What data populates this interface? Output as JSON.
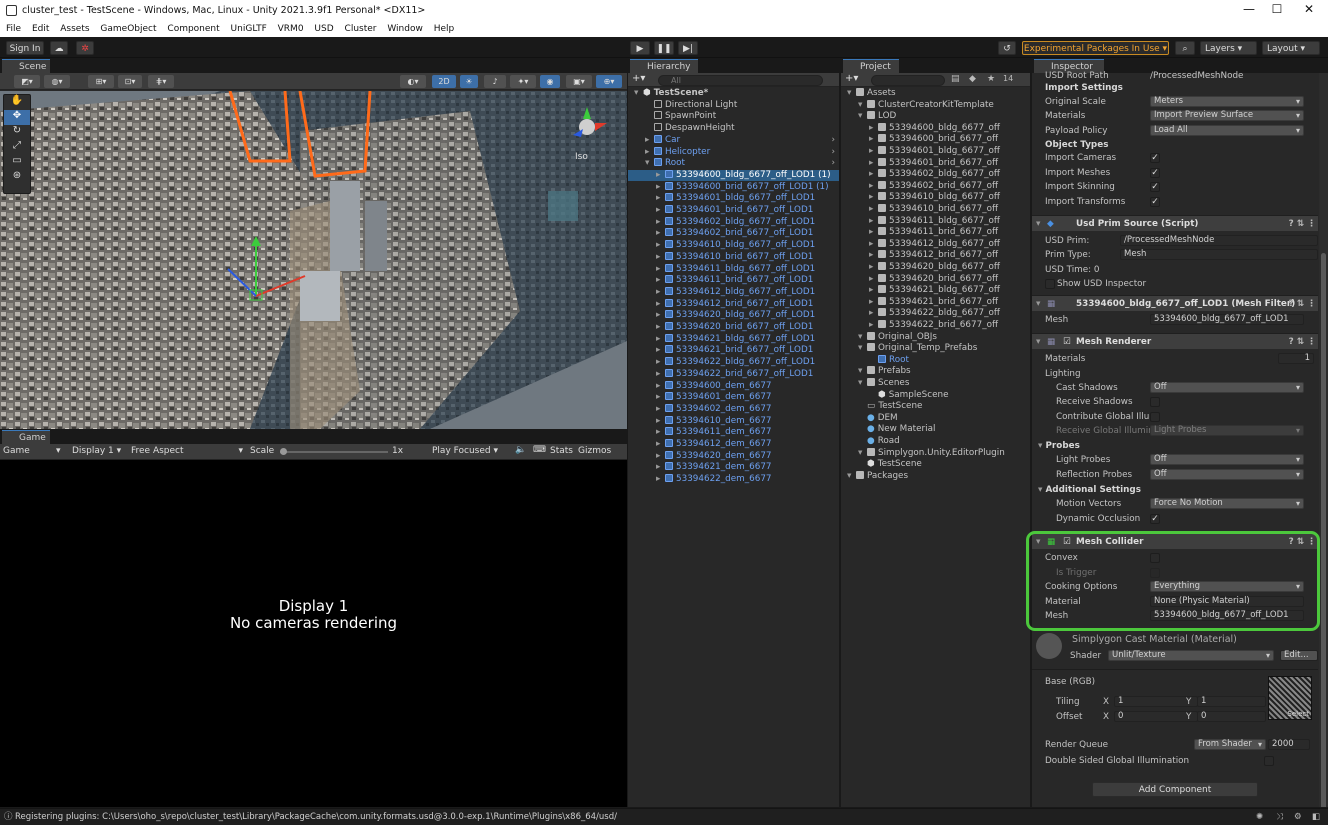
{
  "window": {
    "title": "cluster_test - TestScene - Windows, Mac, Linux - Unity 2021.3.9f1 Personal* <DX11>",
    "min": "—",
    "max": "☐",
    "close": "✕"
  },
  "menu": [
    "File",
    "Edit",
    "Assets",
    "GameObject",
    "Component",
    "UniGLTF",
    "VRM0",
    "USD",
    "Cluster",
    "Window",
    "Help"
  ],
  "toolbar": {
    "sign_in": "Sign In",
    "experimental": "Experimental Packages In Use ▾",
    "layers": "Layers",
    "layout": "Layout"
  },
  "scene": {
    "tab": "Scene",
    "mode_2d": "2D",
    "persp": "Iso",
    "colors": {
      "tab_accent": "#3a79bb",
      "selection": "#ff6a1a"
    }
  },
  "game": {
    "tab": "Game",
    "view": "Game",
    "display": "Display 1",
    "aspect": "Free Aspect",
    "scale_label": "Scale",
    "scale_value": "1x",
    "play_focused": "Play Focused",
    "stats": "Stats",
    "gizmos": "Gizmos",
    "msg_line1": "Display 1",
    "msg_line2": "No cameras rendering"
  },
  "hierarchy": {
    "tab": "Hierarchy",
    "search_placeholder": "All",
    "items": [
      {
        "label": "TestScene*",
        "depth": 0,
        "kind": "scene"
      },
      {
        "label": "Directional Light",
        "depth": 1,
        "kind": "go"
      },
      {
        "label": "SpawnPoint",
        "depth": 1,
        "kind": "go"
      },
      {
        "label": "DespawnHeight",
        "depth": 1,
        "kind": "go"
      },
      {
        "label": "Car",
        "depth": 1,
        "kind": "prefab",
        "arrow": true
      },
      {
        "label": "Helicopter",
        "depth": 1,
        "kind": "prefab",
        "arrow": true
      },
      {
        "label": "Root",
        "depth": 1,
        "kind": "prefab",
        "arrow": true
      },
      {
        "label": "53394600_bldg_6677_off_LOD1 (1)",
        "depth": 2,
        "kind": "prefab",
        "selected": true
      },
      {
        "label": "53394600_brid_6677_off_LOD1 (1)",
        "depth": 2,
        "kind": "prefab"
      },
      {
        "label": "53394601_bldg_6677_off_LOD1",
        "depth": 2,
        "kind": "prefab"
      },
      {
        "label": "53394601_brid_6677_off_LOD1",
        "depth": 2,
        "kind": "prefab"
      },
      {
        "label": "53394602_bldg_6677_off_LOD1",
        "depth": 2,
        "kind": "prefab"
      },
      {
        "label": "53394602_brid_6677_off_LOD1",
        "depth": 2,
        "kind": "prefab"
      },
      {
        "label": "53394610_bldg_6677_off_LOD1",
        "depth": 2,
        "kind": "prefab"
      },
      {
        "label": "53394610_brid_6677_off_LOD1",
        "depth": 2,
        "kind": "prefab"
      },
      {
        "label": "53394611_bldg_6677_off_LOD1",
        "depth": 2,
        "kind": "prefab"
      },
      {
        "label": "53394611_brid_6677_off_LOD1",
        "depth": 2,
        "kind": "prefab"
      },
      {
        "label": "53394612_bldg_6677_off_LOD1",
        "depth": 2,
        "kind": "prefab"
      },
      {
        "label": "53394612_brid_6677_off_LOD1",
        "depth": 2,
        "kind": "prefab"
      },
      {
        "label": "53394620_bldg_6677_off_LOD1",
        "depth": 2,
        "kind": "prefab"
      },
      {
        "label": "53394620_brid_6677_off_LOD1",
        "depth": 2,
        "kind": "prefab"
      },
      {
        "label": "53394621_bldg_6677_off_LOD1",
        "depth": 2,
        "kind": "prefab"
      },
      {
        "label": "53394621_brid_6677_off_LOD1",
        "depth": 2,
        "kind": "prefab"
      },
      {
        "label": "53394622_bldg_6677_off_LOD1",
        "depth": 2,
        "kind": "prefab"
      },
      {
        "label": "53394622_brid_6677_off_LOD1",
        "depth": 2,
        "kind": "prefab"
      },
      {
        "label": "53394600_dem_6677",
        "depth": 2,
        "kind": "prefab"
      },
      {
        "label": "53394601_dem_6677",
        "depth": 2,
        "kind": "prefab"
      },
      {
        "label": "53394602_dem_6677",
        "depth": 2,
        "kind": "prefab"
      },
      {
        "label": "53394610_dem_6677",
        "depth": 2,
        "kind": "prefab"
      },
      {
        "label": "53394611_dem_6677",
        "depth": 2,
        "kind": "prefab"
      },
      {
        "label": "53394612_dem_6677",
        "depth": 2,
        "kind": "prefab"
      },
      {
        "label": "53394620_dem_6677",
        "depth": 2,
        "kind": "prefab"
      },
      {
        "label": "53394621_dem_6677",
        "depth": 2,
        "kind": "prefab"
      },
      {
        "label": "53394622_dem_6677",
        "depth": 2,
        "kind": "prefab"
      }
    ]
  },
  "project": {
    "tab": "Project",
    "count": "14",
    "items": [
      {
        "label": "Assets",
        "depth": 0,
        "kind": "folder"
      },
      {
        "label": "ClusterCreatorKitTemplate",
        "depth": 1,
        "kind": "folder"
      },
      {
        "label": "LOD",
        "depth": 1,
        "kind": "folder"
      },
      {
        "label": "53394600_bldg_6677_off",
        "depth": 2,
        "kind": "folder"
      },
      {
        "label": "53394600_brid_6677_off",
        "depth": 2,
        "kind": "folder"
      },
      {
        "label": "53394601_bldg_6677_off",
        "depth": 2,
        "kind": "folder"
      },
      {
        "label": "53394601_brid_6677_off",
        "depth": 2,
        "kind": "folder"
      },
      {
        "label": "53394602_bldg_6677_off",
        "depth": 2,
        "kind": "folder"
      },
      {
        "label": "53394602_brid_6677_off",
        "depth": 2,
        "kind": "folder"
      },
      {
        "label": "53394610_bldg_6677_off",
        "depth": 2,
        "kind": "folder"
      },
      {
        "label": "53394610_brid_6677_off",
        "depth": 2,
        "kind": "folder"
      },
      {
        "label": "53394611_bldg_6677_off",
        "depth": 2,
        "kind": "folder"
      },
      {
        "label": "53394611_brid_6677_off",
        "depth": 2,
        "kind": "folder"
      },
      {
        "label": "53394612_bldg_6677_off",
        "depth": 2,
        "kind": "folder"
      },
      {
        "label": "53394612_brid_6677_off",
        "depth": 2,
        "kind": "folder"
      },
      {
        "label": "53394620_bldg_6677_off",
        "depth": 2,
        "kind": "folder"
      },
      {
        "label": "53394620_brid_6677_off",
        "depth": 2,
        "kind": "folder"
      },
      {
        "label": "53394621_bldg_6677_off",
        "depth": 2,
        "kind": "folder"
      },
      {
        "label": "53394621_brid_6677_off",
        "depth": 2,
        "kind": "folder"
      },
      {
        "label": "53394622_bldg_6677_off",
        "depth": 2,
        "kind": "folder"
      },
      {
        "label": "53394622_brid_6677_off",
        "depth": 2,
        "kind": "folder"
      },
      {
        "label": "Original_OBJs",
        "depth": 1,
        "kind": "folder"
      },
      {
        "label": "Original_Temp_Prefabs",
        "depth": 1,
        "kind": "folder"
      },
      {
        "label": "Root",
        "depth": 2,
        "kind": "prefab"
      },
      {
        "label": "Prefabs",
        "depth": 1,
        "kind": "folder"
      },
      {
        "label": "Scenes",
        "depth": 1,
        "kind": "folder"
      },
      {
        "label": "SampleScene",
        "depth": 2,
        "kind": "scene"
      },
      {
        "label": "TestScene",
        "depth": 1,
        "kind": "file"
      },
      {
        "label": "DEM",
        "depth": 1,
        "kind": "material"
      },
      {
        "label": "New Material",
        "depth": 1,
        "kind": "material"
      },
      {
        "label": "Road",
        "depth": 1,
        "kind": "material"
      },
      {
        "label": "Simplygon.Unity.EditorPlugin",
        "depth": 1,
        "kind": "folder"
      },
      {
        "label": "TestScene",
        "depth": 1,
        "kind": "scene"
      },
      {
        "label": "Packages",
        "depth": 0,
        "kind": "folder"
      }
    ]
  },
  "inspector": {
    "tab": "Inspector",
    "usd_root_path_label": "USD Root Path",
    "usd_root_path": "/ProcessedMeshNode",
    "import_settings": "Import Settings",
    "original_scale_label": "Original Scale",
    "original_scale": "Meters",
    "materials_label": "Materials",
    "materials": "Import Preview Surface",
    "payload_label": "Payload Policy",
    "payload": "Load All",
    "object_types": "Object Types",
    "import_cameras": "Import Cameras",
    "import_meshes": "Import Meshes",
    "import_skinning": "Import Skinning",
    "import_transforms": "Import Transforms",
    "prim_source_title": "Usd Prim Source (Script)",
    "usd_prim_label": "USD Prim:",
    "usd_prim": "/ProcessedMeshNode",
    "prim_type_label": "Prim Type:",
    "prim_type": "Mesh",
    "usd_time": "USD Time: 0",
    "show_usd": "Show USD Inspector",
    "mesh_filter_title": "53394600_bldg_6677_off_LOD1 (Mesh Filter)",
    "mesh_label": "Mesh",
    "mesh_value": "53394600_bldg_6677_off_LOD1",
    "renderer_title": "Mesh Renderer",
    "r_materials": "Materials",
    "r_materials_count": "1",
    "lighting": "Lighting",
    "cast_shadows": "Cast Shadows",
    "cast_shadows_v": "Off",
    "receive_shadows": "Receive Shadows",
    "contrib_gi": "Contribute Global Illum",
    "receive_gi": "Receive Global Illumina",
    "receive_gi_v": "Light Probes",
    "probes": "Probes",
    "light_probes": "Light Probes",
    "light_probes_v": "Off",
    "refl_probes": "Reflection Probes",
    "refl_probes_v": "Off",
    "additional": "Additional Settings",
    "motion_vectors": "Motion Vectors",
    "motion_vectors_v": "Force No Motion",
    "dynamic_occlusion": "Dynamic Occlusion",
    "collider_title": "Mesh Collider",
    "convex": "Convex",
    "is_trigger": "Is Trigger",
    "cooking": "Cooking Options",
    "cooking_v": "Everything",
    "c_material": "Material",
    "c_material_v": "None (Physic Material)",
    "c_mesh": "Mesh",
    "c_mesh_v": "53394600_bldg_6677_off_LOD1",
    "mat_title": "Simplygon Cast Material (Material)",
    "shader_label": "Shader",
    "shader_v": "Unlit/Texture",
    "edit": "Edit...",
    "base_rgb": "Base (RGB)",
    "tiling": "Tiling",
    "offset": "Offset",
    "x": "X",
    "y": "Y",
    "tiling_x": "1",
    "tiling_y": "1",
    "offset_x": "0",
    "offset_y": "0",
    "select": "Select",
    "render_queue": "Render Queue",
    "render_queue_mode": "From Shader",
    "render_queue_v": "2000",
    "double_sided": "Double Sided Global Illumination",
    "add_component": "Add Component",
    "highlight_color": "#4cc83c"
  },
  "status": {
    "text": "Registering plugins: C:\\Users\\oho_s\\repo\\cluster_test\\Library\\PackageCache\\com.unity.formats.usd@3.0.0-exp.1\\Runtime\\Plugins\\x86_64/usd/"
  }
}
